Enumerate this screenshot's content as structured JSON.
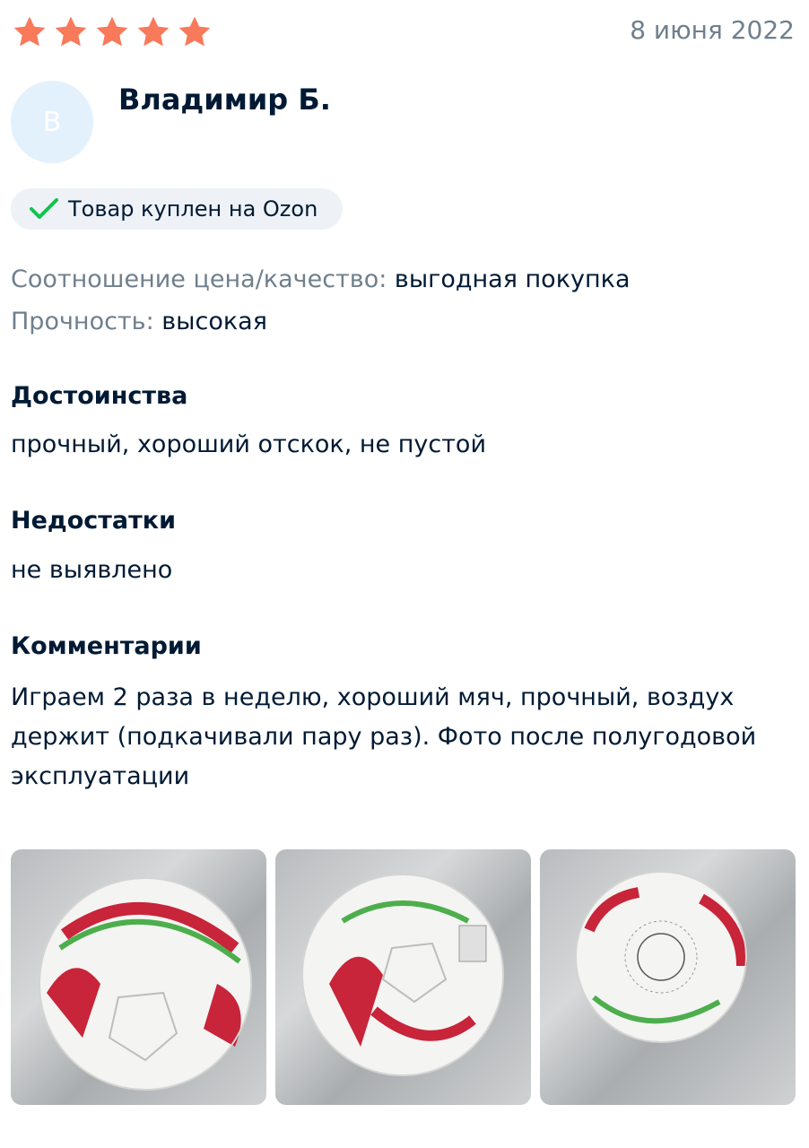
{
  "review": {
    "rating": 5,
    "rating_max": 5,
    "date": "8 июня 2022",
    "author": {
      "name": "Владимир Б.",
      "initial": "В"
    },
    "badge": {
      "icon": "check-icon",
      "label": "Товар куплен на Ozon"
    },
    "attributes": [
      {
        "key": "Соотношение цена/качество:",
        "value": "выгодная покупка"
      },
      {
        "key": "Прочность:",
        "value": "высокая"
      }
    ],
    "pros": {
      "title": "Достоинства",
      "text": "прочный, хороший отскок, не пустой"
    },
    "cons": {
      "title": "Недостатки",
      "text": "не выявлено"
    },
    "comment": {
      "title": "Комментарии",
      "text": "Играем 2 раза в неделю, хороший мяч, прочный, воздух держит (подкачивали пару раз). Фото после полугодовой эксплуатации"
    },
    "photos": [
      {
        "content": "football-photo"
      },
      {
        "content": "football-photo"
      },
      {
        "content": "football-photo"
      }
    ]
  },
  "colors": {
    "star": "#f9795b",
    "check": "#10c44c",
    "muted_text": "#707f8d",
    "main_text": "#001a34",
    "avatar_bg": "#e3f1fd",
    "badge_bg": "#eef2f7"
  }
}
